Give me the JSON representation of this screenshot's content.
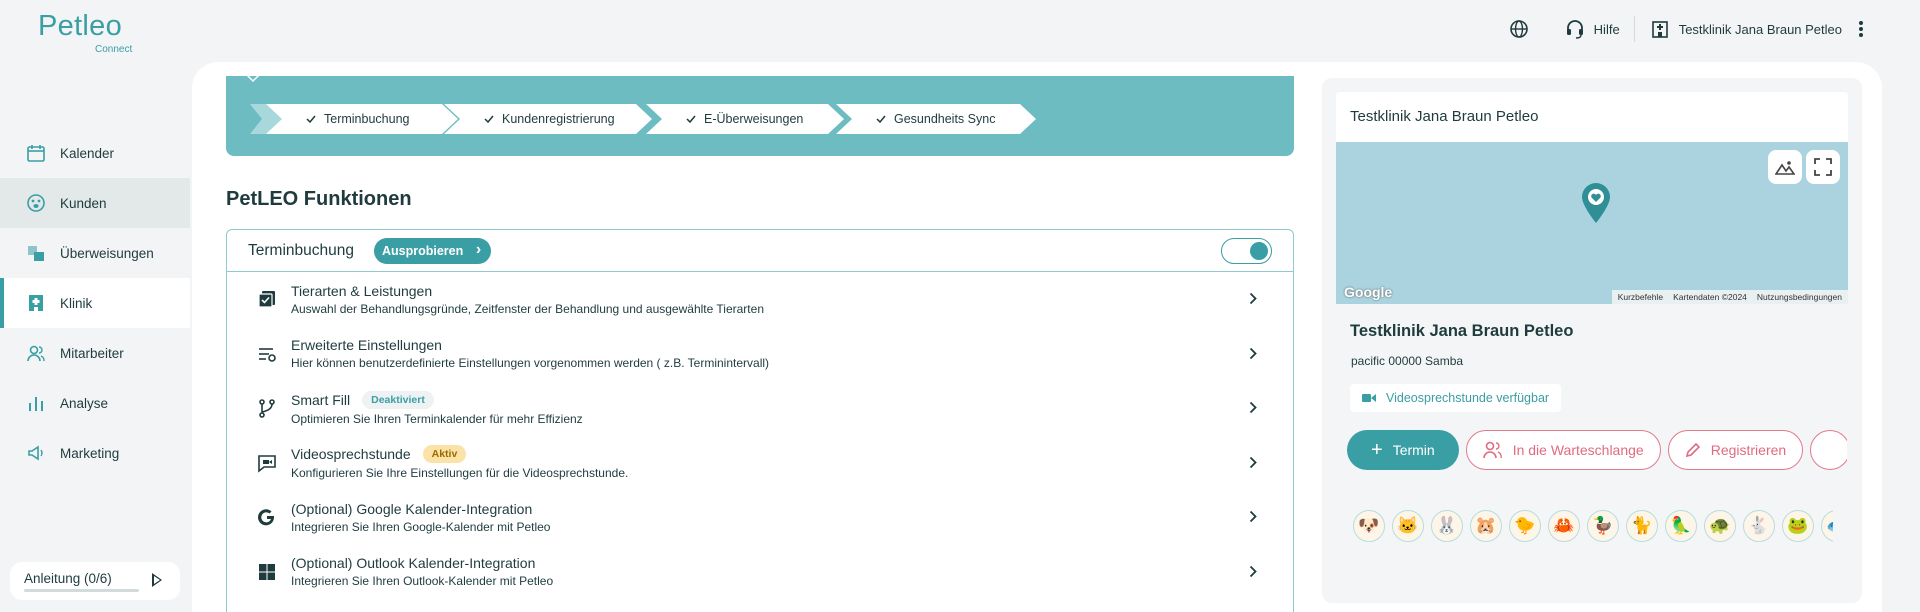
{
  "brand": {
    "name": "Petleo",
    "tagline": "Connect"
  },
  "header": {
    "help_label": "Hilfe",
    "clinic_name": "Testklinik Jana Braun Petleo"
  },
  "sidebar": {
    "items": [
      {
        "label": "Kalender",
        "icon": "calendar-icon"
      },
      {
        "label": "Kunden",
        "icon": "paw-icon"
      },
      {
        "label": "Überweisungen",
        "icon": "transfer-icon"
      },
      {
        "label": "Klinik",
        "icon": "hospital-icon"
      },
      {
        "label": "Mitarbeiter",
        "icon": "users-icon"
      },
      {
        "label": "Analyse",
        "icon": "bar-chart-icon"
      },
      {
        "label": "Marketing",
        "icon": "megaphone-icon"
      }
    ],
    "active": "Klinik",
    "hover": "Kunden",
    "guide_label": "Anleitung (0/6)"
  },
  "steps": [
    "Terminbuchung",
    "Kundenregistrierung",
    "E-Überweisungen",
    "Gesundheits Sync"
  ],
  "functions": {
    "title": "PetLEO Funktionen",
    "card_title": "Terminbuchung",
    "try_label": "Ausprobieren",
    "toggle_on": true,
    "rows": [
      {
        "title": "Tierarten & Leistungen",
        "desc": "Auswahl der Behandlungsgründe, Zeitfenster der Behandlung und ausgewählte Tierarten",
        "icon": "checklist-icon"
      },
      {
        "title": "Erweiterte Einstellungen",
        "desc": "Hier können benutzerdefinierte Einstellungen vorgenommen werden ( z.B. Terminintervall)",
        "icon": "settings-list-icon"
      },
      {
        "title": "Smart Fill",
        "badge": "Deaktiviert",
        "desc": "Optimieren Sie Ihren Terminkalender für mehr Effizienz",
        "icon": "branch-icon"
      },
      {
        "title": "Videosprechstunde",
        "badge": "Aktiv",
        "desc": "Konfigurieren Sie Ihre Einstellungen für die Videosprechstunde.",
        "icon": "video-chat-icon"
      },
      {
        "title": "(Optional) Google Kalender-Integration",
        "desc": "Integrieren Sie Ihren Google-Kalender mit Petleo",
        "icon": "google-icon"
      },
      {
        "title": "(Optional) Outlook Kalender-Integration",
        "desc": "Integrieren Sie Ihren Outlook-Kalender mit Petleo",
        "icon": "windows-icon"
      }
    ]
  },
  "clinic_card": {
    "title": "Testklinik Jana Braun Petleo",
    "name": "Testklinik Jana Braun Petleo",
    "address": "pacific 00000 Samba",
    "video_label": "Videosprechstunde verfügbar",
    "map": {
      "google_label": "Google",
      "footer": [
        "Kurzbefehle",
        "Kartendaten ©2024",
        "Nutzungsbedingungen"
      ]
    },
    "buttons": {
      "appointment": "Termin",
      "queue": "In die Warteschlange",
      "register": "Registrieren"
    },
    "animals": [
      "🐶",
      "🐱",
      "🐰",
      "🐹",
      "🐤",
      "🦀",
      "🦆",
      "🐈",
      "🦜",
      "🐢",
      "🐇",
      "🐸",
      "🐟"
    ]
  },
  "colors": {
    "accent": "#3a9ea5",
    "banner": "#6cbcc2",
    "pink": "#e06b80",
    "map": "#aad3df"
  }
}
